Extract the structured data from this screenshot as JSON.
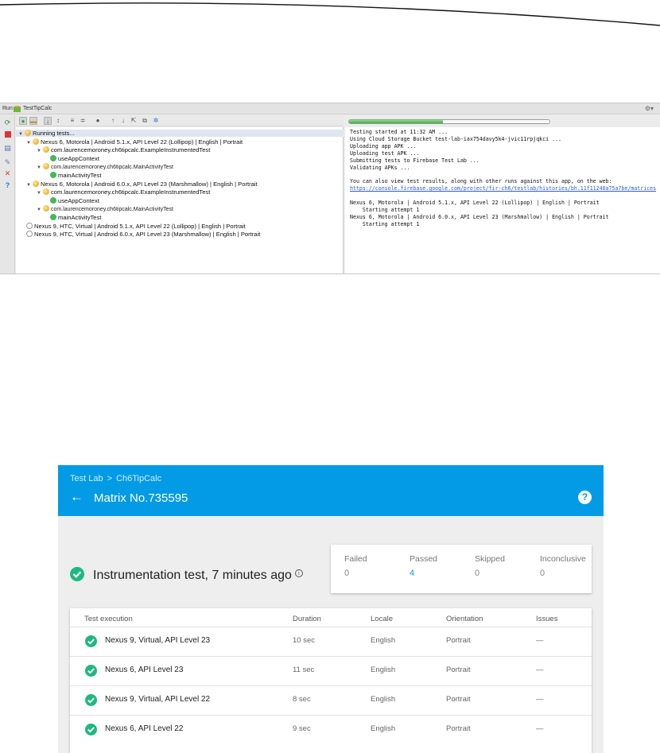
{
  "ide": {
    "window_label": "Run",
    "config_name": "TestTipCalc",
    "gear_glyph": "⚙▾",
    "left_toolbar_icons": [
      "rerun-icon",
      "stop-icon",
      "layout-icon",
      "pin-icon",
      "close-icon",
      "help-icon"
    ],
    "toolbar_icons": [
      "show-passed-icon",
      "show-ignored-icon",
      "sort-alpha-icon",
      "sort-duration-icon",
      "expand-all-icon",
      "collapse-all-icon",
      "track-running-icon",
      "prev-failed-icon",
      "next-failed-icon",
      "export-icon",
      "import-icon",
      "settings-icon"
    ],
    "progress": 0.47,
    "tree": [
      {
        "indent": 0,
        "arrow": "▼",
        "status": "pending",
        "label": "Running tests..."
      },
      {
        "indent": 1,
        "arrow": "▼",
        "status": "pending",
        "label": "Nexus 6, Motorola | Android 5.1.x, API Level 22 (Lollipop) | English | Portrait"
      },
      {
        "indent": 2,
        "arrow": "▼",
        "status": "pending",
        "label": "com.laurencemoroney.ch6tipcalc.ExampleInstrumentedTest"
      },
      {
        "indent": 3,
        "arrow": "",
        "status": "pass",
        "label": "useAppContext"
      },
      {
        "indent": 2,
        "arrow": "▼",
        "status": "pending",
        "label": "com.laurencemoroney.ch6tipcalc.MainActivityTest",
        "small": true
      },
      {
        "indent": 3,
        "arrow": "",
        "status": "pass",
        "label": "mainActivityTest"
      },
      {
        "indent": 1,
        "arrow": "▼",
        "status": "pending",
        "label": "Nexus 6, Motorola | Android 6.0.x, API Level 23 (Marshmallow) | English | Portrait"
      },
      {
        "indent": 2,
        "arrow": "▼",
        "status": "pending",
        "label": "com.laurencemoroney.ch6tipcalc.ExampleInstrumentedTest"
      },
      {
        "indent": 3,
        "arrow": "",
        "status": "pass",
        "label": "useAppContext"
      },
      {
        "indent": 2,
        "arrow": "▼",
        "status": "pending",
        "label": "com.laurencemoroney.ch6tipcalc.MainActivityTest",
        "small": true
      },
      {
        "indent": 3,
        "arrow": "",
        "status": "pass",
        "label": "mainActivityTest"
      },
      {
        "indent": 1,
        "arrow": "",
        "status": "wait",
        "label": "Nexus 9, HTC, Virtual | Android 5.1.x, API Level 22 (Lollipop) | English | Portrait"
      },
      {
        "indent": 1,
        "arrow": "",
        "status": "wait",
        "label": "Nexus 9, HTC, Virtual | Android 6.0.x, API Level 23 (Marshmallow) | English | Portrait"
      }
    ],
    "console": [
      {
        "text": "Testing started at 11:32 AM ..."
      },
      {
        "text": "Using Cloud Storage Bucket test-lab-iax754davy5k4-jvic11rpjqkci ..."
      },
      {
        "text": "Uploading app APK ..."
      },
      {
        "text": "Uploading test APK ..."
      },
      {
        "text": "Submitting tests to Firebase Test Lab ..."
      },
      {
        "text": "Validating APKs ..."
      },
      {
        "text": ""
      },
      {
        "text": "You can also view test results, along with other runs against this app, on the web:"
      },
      {
        "text": "https://console.firebase.google.com/project/fir-ch6/testlab/histories/bh.11f11240a75a7be/matrices",
        "link": true
      },
      {
        "text": ""
      },
      {
        "text": "Nexus 6, Motorola | Android 5.1.x, API Level 22 (Lollipop) | English | Portrait"
      },
      {
        "text": "    Starting attempt 1"
      },
      {
        "text": "Nexus 6, Motorola | Android 6.0.x, API Level 23 (Marshmallow) | English | Portrait"
      },
      {
        "text": "    Starting attempt 1"
      }
    ]
  },
  "firebase": {
    "breadcrumb_root": "Test Lab",
    "breadcrumb_sep": ">",
    "breadcrumb_app": "Ch6TipCalc",
    "back_glyph": "←",
    "matrix_title": "Matrix No.735595",
    "help_glyph": "?",
    "summary_title": "Instrumentation test, 7 minutes ago",
    "info_glyph": "i",
    "stats": [
      {
        "label": "Failed",
        "value": "0"
      },
      {
        "label": "Passed",
        "value": "4"
      },
      {
        "label": "Skipped",
        "value": "0"
      },
      {
        "label": "Inconclusive",
        "value": "0"
      }
    ],
    "table": {
      "headers": [
        "Test execution",
        "Duration",
        "Locale",
        "Orientation",
        "Issues"
      ],
      "rows": [
        {
          "name": "Nexus 9, Virtual, API Level 23",
          "duration": "10 sec",
          "locale": "English",
          "orientation": "Portrait",
          "issues": "—"
        },
        {
          "name": "Nexus 6, API Level 23",
          "duration": "11 sec",
          "locale": "English",
          "orientation": "Portrait",
          "issues": "—"
        },
        {
          "name": "Nexus 9, Virtual, API Level 22",
          "duration": "8 sec",
          "locale": "English",
          "orientation": "Portrait",
          "issues": "—"
        },
        {
          "name": "Nexus 6, API Level 22",
          "duration": "9 sec",
          "locale": "English",
          "orientation": "Portrait",
          "issues": "—"
        }
      ]
    },
    "colors": {
      "header": "#039be5",
      "success": "#1eb980",
      "passed_value": "#039be5"
    }
  }
}
